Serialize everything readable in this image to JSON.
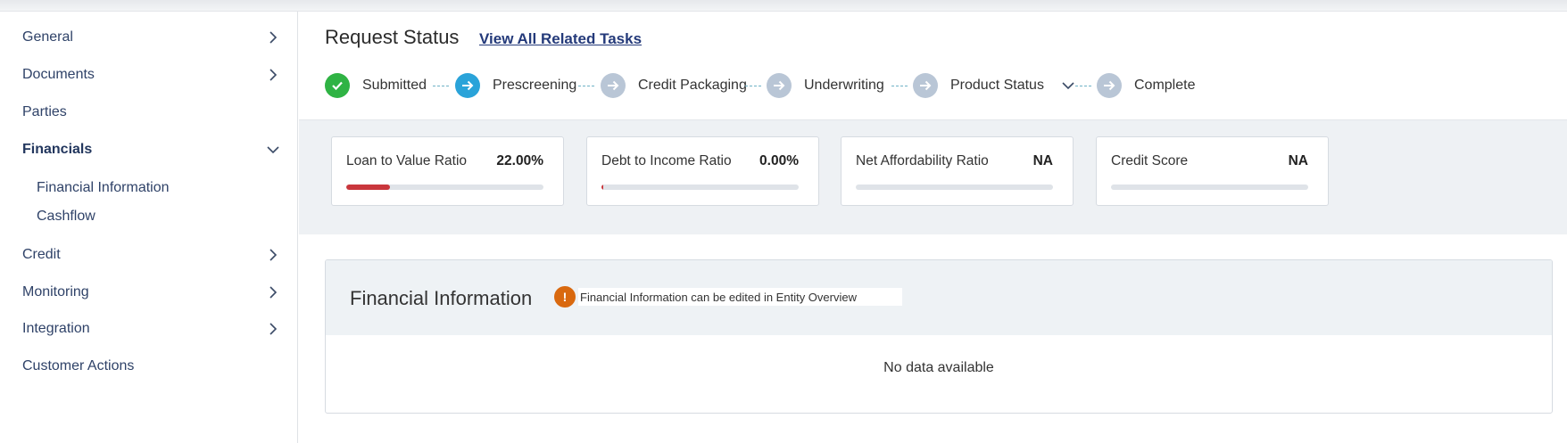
{
  "sidebar": {
    "items": [
      {
        "label": "General",
        "chevron": "right"
      },
      {
        "label": "Documents",
        "chevron": "right"
      },
      {
        "label": "Parties",
        "chevron": ""
      },
      {
        "label": "Financials",
        "chevron": "down"
      },
      {
        "label": "Credit",
        "chevron": "right"
      },
      {
        "label": "Monitoring",
        "chevron": "right"
      },
      {
        "label": "Integration",
        "chevron": "right"
      },
      {
        "label": "Customer Actions",
        "chevron": ""
      }
    ],
    "subitems": [
      {
        "label": "Financial Information"
      },
      {
        "label": "Cashflow"
      }
    ]
  },
  "status": {
    "title": "Request Status",
    "link": "View All Related Tasks",
    "steps": [
      {
        "label": "Submitted",
        "state": "done"
      },
      {
        "label": "Prescreening",
        "state": "current"
      },
      {
        "label": "Credit Packaging",
        "state": "pending"
      },
      {
        "label": "Underwriting",
        "state": "pending"
      },
      {
        "label": "Product Status",
        "state": "pending"
      },
      {
        "label": "Complete",
        "state": "pending"
      }
    ]
  },
  "metrics": [
    {
      "label": "Loan to Value Ratio",
      "value": "22.00%",
      "fill": 0.22
    },
    {
      "label": "Debt to Income Ratio",
      "value": "0.00%",
      "fill": 0.0
    },
    {
      "label": "Net Affordability Ratio",
      "value": "NA",
      "fill": null
    },
    {
      "label": "Credit Score",
      "value": "NA",
      "fill": null
    }
  ],
  "panel": {
    "title": "Financial Information",
    "warning": "Financial Information can be edited in Entity Overview",
    "empty": "No data available"
  },
  "colors": {
    "done": "#2fb344",
    "current": "#2aa3d9",
    "pending": "#b9c6d6",
    "bar": "#c9363c",
    "warning": "#d9690f"
  }
}
